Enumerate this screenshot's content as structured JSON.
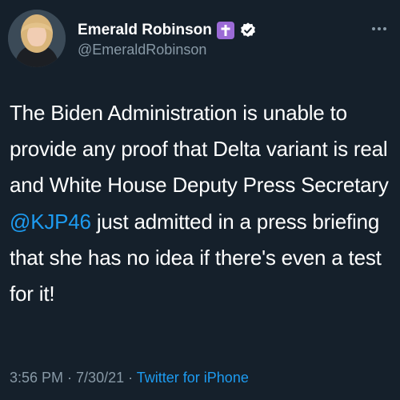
{
  "author": {
    "display_name": "Emerald Robinson",
    "handle": "@EmeraldRobinson",
    "badges": [
      "cross-icon",
      "verified-icon"
    ]
  },
  "tweet": {
    "text_before": "The Biden Administration is unable to provide any proof that Delta variant is real and White House Deputy Press Secretary ",
    "mention": "@KJP46",
    "text_after": " just admitted in a press briefing that she has no idea if there's even a test for it!"
  },
  "meta": {
    "time": "3:56 PM",
    "separator1": " · ",
    "date": "7/30/21",
    "separator2": " · ",
    "source": "Twitter for iPhone"
  },
  "colors": {
    "background": "#15202b",
    "text": "#ffffff",
    "secondary": "#8899a6",
    "link": "#1d9bf0",
    "cross_badge": "#9b6ad6"
  }
}
